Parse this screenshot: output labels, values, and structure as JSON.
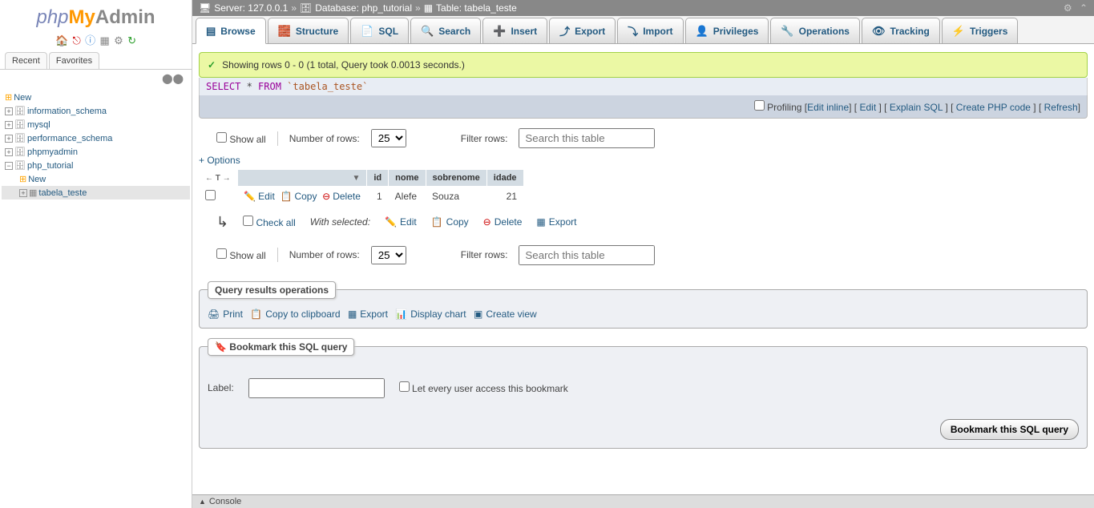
{
  "logo": {
    "php": "php",
    "my": "My",
    "admin": "Admin"
  },
  "sidebar_tabs": {
    "recent": "Recent",
    "favorites": "Favorites"
  },
  "tree": {
    "new": "New",
    "databases": [
      "information_schema",
      "mysql",
      "performance_schema",
      "phpmyadmin"
    ],
    "current_db": "php_tutorial",
    "current_db_new": "New",
    "current_table": "tabela_teste"
  },
  "breadcrumb": {
    "server_label": "Server:",
    "server": "127.0.0.1",
    "database_label": "Database:",
    "database": "php_tutorial",
    "table_label": "Table:",
    "table": "tabela_teste"
  },
  "tabs": {
    "browse": "Browse",
    "structure": "Structure",
    "sql": "SQL",
    "search": "Search",
    "insert": "Insert",
    "export": "Export",
    "import": "Import",
    "privileges": "Privileges",
    "operations": "Operations",
    "tracking": "Tracking",
    "triggers": "Triggers"
  },
  "success_msg": "Showing rows 0 - 0 (1 total, Query took 0.0013 seconds.)",
  "sql": {
    "select": "SELECT",
    "star": " * ",
    "from": "FROM",
    "table": " `tabela_teste`"
  },
  "action_bar": {
    "profiling": "Profiling",
    "edit_inline": "Edit inline",
    "edit": "Edit",
    "explain": "Explain SQL",
    "create_php": "Create PHP code",
    "refresh": "Refresh"
  },
  "controls": {
    "show_all": "Show all",
    "num_rows_label": "Number of rows:",
    "num_rows_value": "25",
    "filter_label": "Filter rows:",
    "filter_placeholder": "Search this table"
  },
  "options_link": "+ Options",
  "columns": {
    "id": "id",
    "nome": "nome",
    "sobrenome": "sobrenome",
    "idade": "idade"
  },
  "row_actions": {
    "edit": "Edit",
    "copy": "Copy",
    "delete": "Delete"
  },
  "row": {
    "id": "1",
    "nome": "Alefe",
    "sobrenome": "Souza",
    "idade": "21"
  },
  "bulk": {
    "check_all": "Check all",
    "with_selected": "With selected:",
    "edit": "Edit",
    "copy": "Copy",
    "delete": "Delete",
    "export": "Export"
  },
  "results_ops": {
    "legend": "Query results operations",
    "print": "Print",
    "copy_clipboard": "Copy to clipboard",
    "export": "Export",
    "display_chart": "Display chart",
    "create_view": "Create view"
  },
  "bookmark": {
    "legend": "Bookmark this SQL query",
    "label": "Label:",
    "let_every": "Let every user access this bookmark",
    "button": "Bookmark this SQL query"
  },
  "console": "Console"
}
